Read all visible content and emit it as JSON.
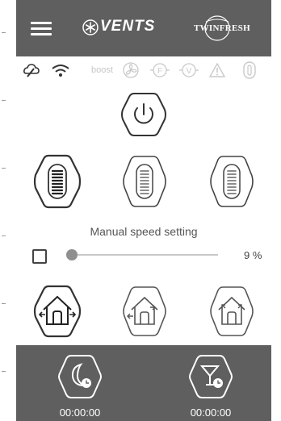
{
  "header": {
    "brand_name": "VENTS",
    "partner_name": "TWINFRESH",
    "menu_icon": "hamburger-menu-icon",
    "logo_icon": "snowflake-logo-icon"
  },
  "status_bar": {
    "boost_label": "boost",
    "icons": [
      "cloud-connection-icon",
      "wifi-icon",
      "boost-indicator",
      "fan-icon",
      "filter-timer-icon",
      "filter-warning-icon",
      "alarm-icon",
      "device-status-icon"
    ]
  },
  "controls": {
    "power_icon": "power-icon",
    "speed_buttons": [
      "speed-high-button",
      "speed-medium-button",
      "speed-low-button"
    ],
    "manual_speed_caption": "Manual speed setting",
    "manual_speed_value": 9,
    "manual_speed_value_text": "9 %",
    "manual_speed_checkbox_checked": false
  },
  "modes": [
    "ventilation-mode-button",
    "heat-recovery-mode-button",
    "supply-mode-button"
  ],
  "footer": {
    "night_timer_icon": "moon-clock-icon",
    "night_timer_value": "00:00:00",
    "party_timer_icon": "cocktail-clock-icon",
    "party_timer_value": "00:00:00"
  },
  "colors": {
    "header_bg": "#5f5f5f",
    "footer_bg": "#5f5f5f",
    "icon_stroke": "#4a4a4a",
    "faded_icon": "#c9c9c9"
  }
}
